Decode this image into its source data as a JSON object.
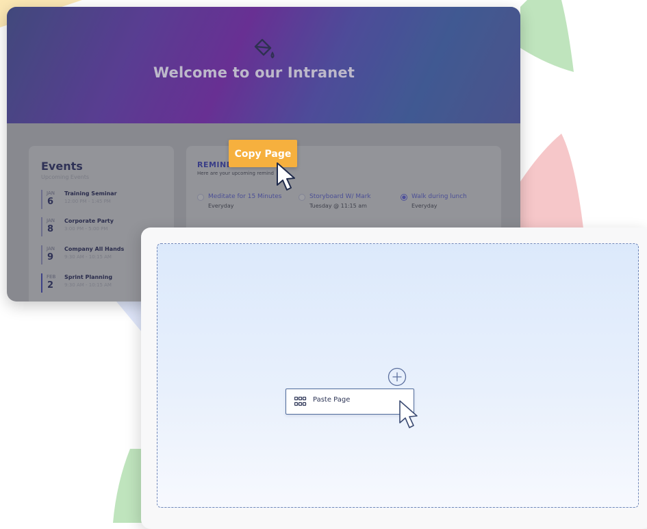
{
  "hero": {
    "title": "Welcome to our Intranet",
    "icon": "paint-bucket-icon"
  },
  "events": {
    "title": "Events",
    "subtitle": "Upcoming Events",
    "items": [
      {
        "month": "JAN",
        "day": "6",
        "name": "Training Seminar",
        "time": "12:00 PM - 1:45 PM"
      },
      {
        "month": "JAN",
        "day": "8",
        "name": "Corporate Party",
        "time": "3:00 PM - 5:00 PM"
      },
      {
        "month": "JAN",
        "day": "9",
        "name": "Company All Hands",
        "time": "9:30 AM - 10:15 AM"
      },
      {
        "month": "FEB",
        "day": "2",
        "name": "Sprint Planning",
        "time": "9:30 AM - 10:15 AM"
      }
    ]
  },
  "reminders": {
    "title": "REMIND",
    "subtitle": "Here are your upcoming remind",
    "items": [
      {
        "name": "Meditate for 15 Minutes",
        "when": "Everyday",
        "checked": false
      },
      {
        "name": "Storyboard W/ Mark",
        "when": "Tuesday @ 11:15 am",
        "checked": false
      },
      {
        "name": "Walk during lunch",
        "when": "Everyday",
        "checked": true
      }
    ]
  },
  "copy_button": {
    "label": "Copy Page",
    "color": "#f6b03e"
  },
  "paste_button": {
    "label": "Paste Page",
    "icon": "grid-icon"
  },
  "add_icon": "plus-circle-icon",
  "colors": {
    "drop_zone_border": "#6f86b8",
    "accent": "#3a3f8c"
  }
}
